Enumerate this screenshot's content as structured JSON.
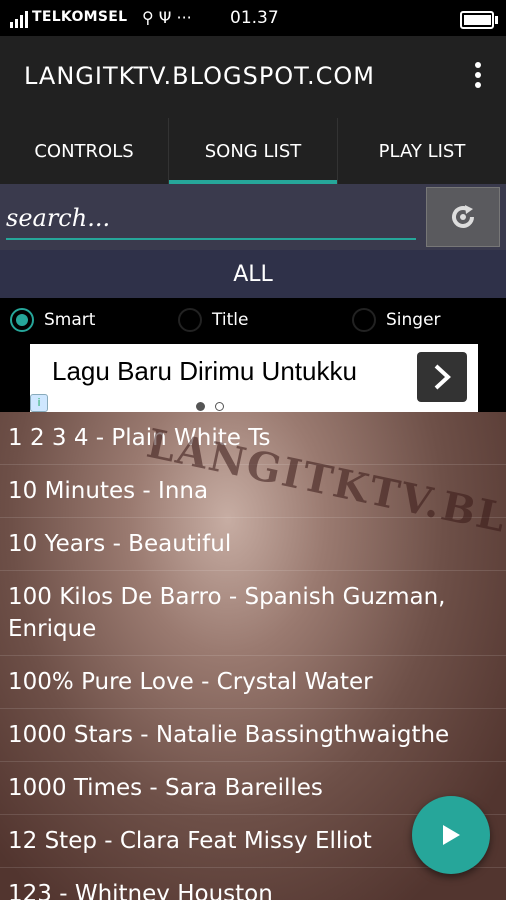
{
  "status": {
    "carrier": "TELKOMSEL",
    "icons": "⚲ Ψ ···",
    "time": "01.37",
    "battery_level": 0.9
  },
  "appbar": {
    "title": "LANGITKTV.BLOGSPOT.COM"
  },
  "tabs": [
    {
      "label": "CONTROLS"
    },
    {
      "label": "SONG LIST"
    },
    {
      "label": "PLAY LIST"
    }
  ],
  "search": {
    "placeholder": "search..."
  },
  "filter": {
    "label": "ALL"
  },
  "radios": [
    {
      "label": "Smart",
      "selected": true
    },
    {
      "label": "Title",
      "selected": false
    },
    {
      "label": "Singer",
      "selected": false
    }
  ],
  "ad": {
    "text": "Lagu Baru Dirimu Untukku",
    "info": "i"
  },
  "watermark": "LANGITKTV.BLOGSPOT.COM",
  "songs": [
    "1 2 3 4 - Plain White Ts",
    "10 Minutes - Inna",
    "10 Years - Beautiful",
    "100 Kilos De Barro - Spanish Guzman, Enrique",
    "100% Pure Love - Crystal Water",
    "1000 Stars - Natalie Bassingthwaigthe",
    "1000 Times - Sara Bareilles",
    "12 Step - Clara Feat Missy Elliot",
    "123 - Whitney Houston"
  ],
  "colors": {
    "accent": "#26a69a",
    "appbar": "#212121",
    "search_bg": "#3a3a4d",
    "all_bg": "#2f3149"
  }
}
